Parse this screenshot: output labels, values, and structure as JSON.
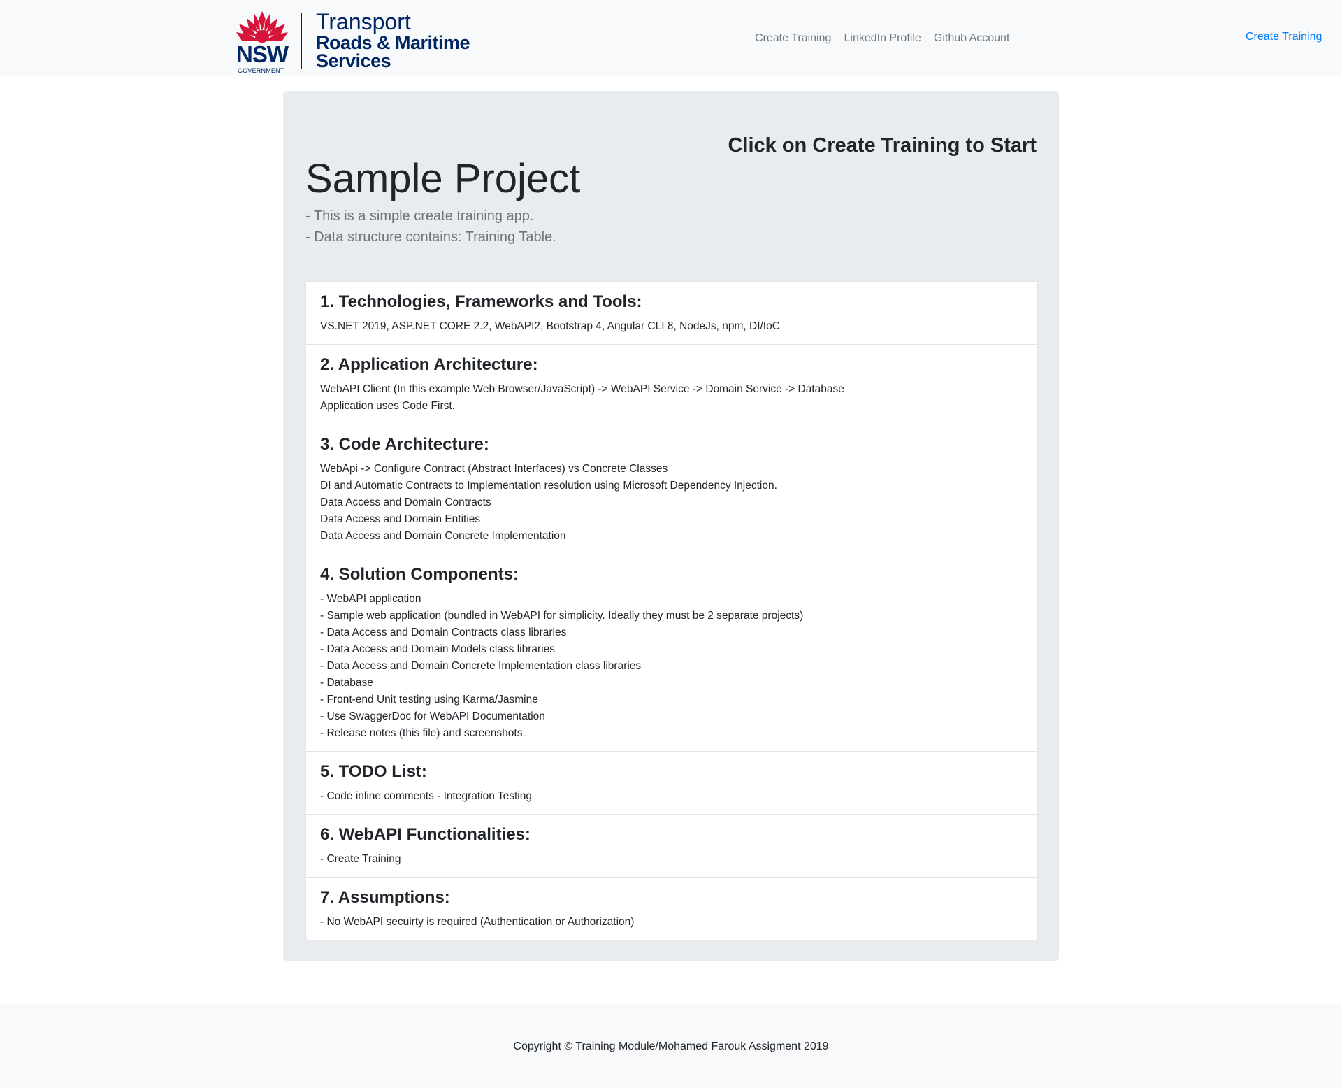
{
  "brand": {
    "nsw": "NSW",
    "government": "GOVERNMENT",
    "line1": "Transport",
    "line2": "Roads & Maritime",
    "line3": "Services"
  },
  "nav": {
    "links": [
      "Create Training",
      "LinkedIn Profile",
      "Github Account"
    ],
    "right_link": "Create Training"
  },
  "jumbotron": {
    "cta": "Click on Create Training to Start",
    "title": "Sample Project",
    "lead": [
      "- This is a simple create training app.",
      "- Data structure contains: Training Table."
    ]
  },
  "sections": [
    {
      "heading": "1. Technologies, Frameworks and Tools:",
      "lines": [
        "VS.NET 2019, ASP.NET CORE 2.2, WebAPI2, Bootstrap 4, Angular CLI 8, NodeJs, npm, DI/IoC"
      ]
    },
    {
      "heading": "2. Application Architecture:",
      "lines": [
        "WebAPI Client (In this example Web Browser/JavaScript) -> WebAPI Service -> Domain Service -> Database",
        "Application uses Code First."
      ]
    },
    {
      "heading": "3. Code Architecture:",
      "lines": [
        "WebApi -> Configure Contract (Abstract Interfaces) vs Concrete Classes",
        "DI and Automatic Contracts to Implementation resolution using Microsoft Dependency Injection.",
        "Data Access and Domain Contracts",
        "Data Access and Domain Entities",
        "Data Access and Domain Concrete Implementation"
      ]
    },
    {
      "heading": "4. Solution Components:",
      "lines": [
        "- WebAPI application",
        "- Sample web application (bundled in WebAPI for simplicity. Ideally they must be 2 separate projects)",
        "- Data Access and Domain Contracts class libraries",
        "- Data Access and Domain Models class libraries",
        "- Data Access and Domain Concrete Implementation class libraries",
        "- Database",
        "- Front-end Unit testing using Karma/Jasmine",
        "- Use SwaggerDoc for WebAPI Documentation",
        "- Release notes (this file) and screenshots."
      ]
    },
    {
      "heading": "5. TODO List:",
      "lines": [
        "- Code inline comments - Integration Testing"
      ]
    },
    {
      "heading": "6. WebAPI Functionalities:",
      "lines": [
        "- Create Training"
      ]
    },
    {
      "heading": "7. Assumptions:",
      "lines": [
        "- No WebAPI secuirty is required (Authentication or Authorization)"
      ]
    }
  ],
  "footer": {
    "copyright": "Copyright © Training Module/Mohamed Farouk Assigment 2019"
  },
  "colors": {
    "brand_navy": "#002664",
    "brand_red": "#d7153a",
    "link_blue": "#007bff",
    "nav_gray": "#6c757d",
    "jumbotron_bg": "#e9ecef"
  }
}
